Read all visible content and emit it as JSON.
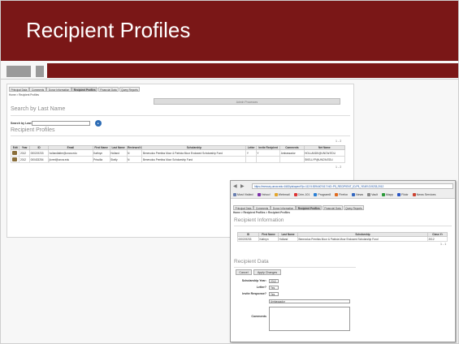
{
  "slide": {
    "title": "Recipient Profiles",
    "colors": {
      "title_band": "#7a1717",
      "accent_bar": "#7a1717",
      "link_blue": "#1a4fa0"
    }
  },
  "screenshot1": {
    "tabs": [
      "Principal Data",
      "Comments",
      "Donor Information",
      "Recipient Profiles",
      "Financial Data",
      "Query Reports"
    ],
    "active_tab": "Recipient Profiles",
    "breadcrumb": "Home > Recipient Profiles",
    "admin_button": "Admin Processes",
    "search_section_title": "Search by Last Name",
    "search_label": "Search by Last Name:",
    "search_value": "",
    "go_icon": "search-go-icon",
    "profiles_section_title": "Recipient Profiles",
    "pager_top": "1 - 2",
    "pager_bottom": "1 - 2",
    "columns": [
      "Edit",
      "Year",
      "ID",
      "Email",
      "First Name",
      "Last Name",
      "Reviewed Ind",
      "Scholarship",
      "Letter",
      "Invite Recipient",
      "Comments",
      "Net Name"
    ],
    "rows": [
      [
        "",
        "2012",
        "000219233",
        "hollandlattre@uncw.edu",
        "Kathryn",
        "Holland",
        "N",
        "Benevolus Prentiss Moor & Patricia Moor Endowed Scholarship Fund",
        "Y",
        "Y",
        "Ambassador",
        "HOLLANDK@UNCW.EDU"
      ],
      [
        "",
        "2012",
        "000433254",
        "jlorrel@uncw.edu",
        "Priscilla",
        "Skelly",
        "N",
        "Benevolus Prentiss Moor Scholarship Fund",
        "",
        "",
        "",
        "SKELLYP@UNCW.EDU"
      ]
    ]
  },
  "screenshot2": {
    "url": "https://mercury.uncw.edu:4443/pls/apex/f?p=112:5:3094407417:NO::P5_RECIPIENT_ID,P5_YEAR:219233,2012",
    "bookmarks": [
      "Most Visited",
      "Yahoo!",
      "Webmail",
      "Crim-101",
      "Program8",
      "Firefox",
      "News",
      "Vault",
      "Mapp",
      "Flickr",
      "News Services"
    ],
    "tabs": [
      "Principal Data",
      "Comments",
      "Donor Information",
      "Recipient Profiles",
      "Financial Data",
      "Query Reports"
    ],
    "active_tab": "Recipient Profiles",
    "breadcrumb": "Home > Recipient Profiles > Recipient Profiles",
    "info_section_title": "Recipient Information",
    "columns": [
      "ID",
      "First Name",
      "Last Name",
      "Scholarship",
      "Class Yr"
    ],
    "rows": [
      [
        "000219233",
        "Kathryn",
        "Holland",
        "Benevolus Prentiss Moor & Patricia Moor Endowed Scholarship Fund",
        "2012"
      ]
    ],
    "pager": "1 - 1",
    "data_section_title": "Recipient Data",
    "cancel_button": "Cancel",
    "apply_button": "Apply Changes",
    "fields": [
      {
        "label": "Scholarship Year:",
        "value": "2012"
      },
      {
        "label": "Letter?",
        "value": "Yes"
      },
      {
        "label": "Invite Response?",
        "value": "Yes"
      }
    ],
    "extra_value": "Ambassador",
    "comments_label": "Comments"
  }
}
